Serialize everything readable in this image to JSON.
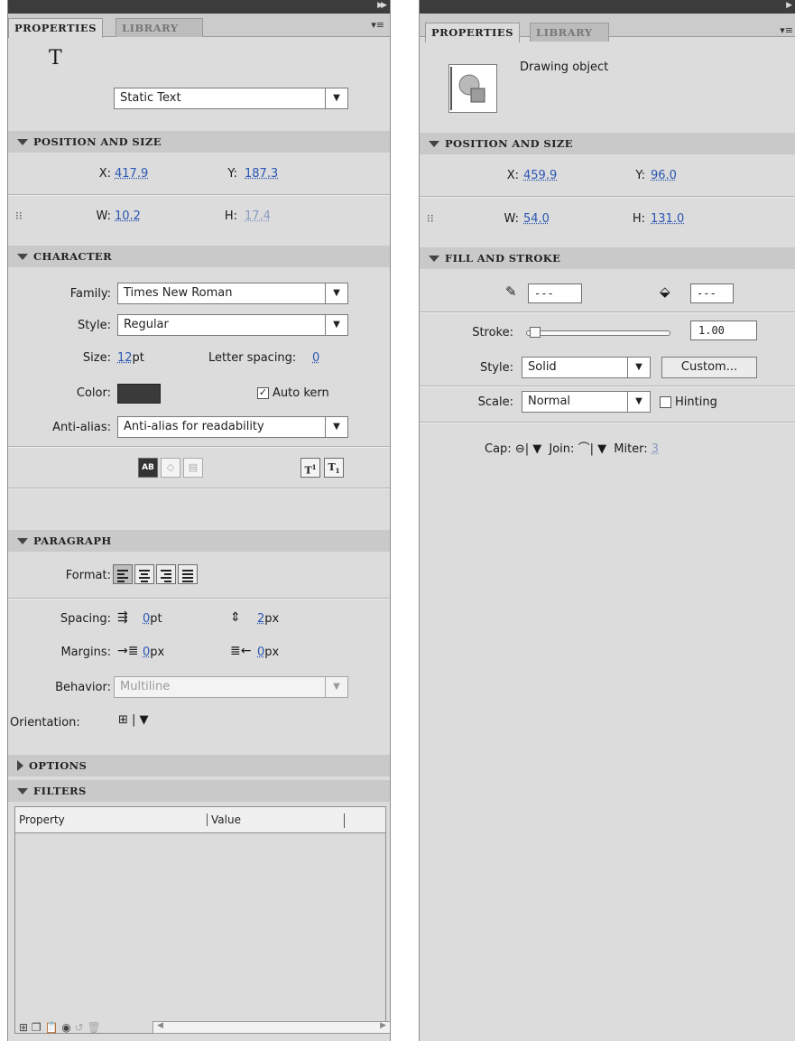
{
  "left": {
    "tabs": [
      "PROPERTIES",
      "LIBRARY"
    ],
    "text_tool_glyph": "T",
    "text_type": "Static Text",
    "position_size": {
      "header": "POSITION AND SIZE",
      "x_label": "X:",
      "x_value": "417.9",
      "y_label": "Y:",
      "y_value": "187.3",
      "w_label": "W:",
      "w_value": "10.2",
      "h_label": "H:",
      "h_value": "17.4"
    },
    "character": {
      "header": "CHARACTER",
      "family_label": "Family:",
      "family_value": "Times New Roman",
      "style_label": "Style:",
      "style_value": "Regular",
      "size_label": "Size:",
      "size_value": "12",
      "size_unit": "pt",
      "letter_spacing_label": "Letter spacing:",
      "letter_spacing_value": "0",
      "color_label": "Color:",
      "color_value": "#3a3a3a",
      "auto_kern_label": "Auto kern",
      "antialias_label": "Anti-alias:",
      "antialias_value": "Anti-alias for readability"
    },
    "paragraph": {
      "header": "PARAGRAPH",
      "format_label": "Format:",
      "spacing_label": "Spacing:",
      "spacing_indent_value": "0",
      "spacing_indent_unit": "pt",
      "spacing_line_value": "2",
      "spacing_line_unit": "px",
      "margins_label": "Margins:",
      "margin_left_value": "0",
      "margin_left_unit": "px",
      "margin_right_value": "0",
      "margin_right_unit": "px",
      "behavior_label": "Behavior:",
      "behavior_value": "Multiline",
      "orientation_label": "Orientation:"
    },
    "options_header": "OPTIONS",
    "filters": {
      "header": "FILTERS",
      "col_property": "Property",
      "col_value": "Value"
    }
  },
  "right": {
    "tabs": [
      "PROPERTIES",
      "LIBRARY"
    ],
    "object_type": "Drawing object",
    "position_size": {
      "header": "POSITION AND SIZE",
      "x_label": "X:",
      "x_value": "459.9",
      "y_label": "Y:",
      "y_value": "96.0",
      "w_label": "W:",
      "w_value": "54.0",
      "h_label": "H:",
      "h_value": "131.0"
    },
    "fill_stroke": {
      "header": "FILL AND STROKE",
      "stroke_color_value": "---",
      "fill_color_value": "---",
      "stroke_label": "Stroke:",
      "stroke_value": "1.00",
      "stroke_slider_fraction": 0.02,
      "style_label": "Style:",
      "style_value": "Solid",
      "custom_button": "Custom...",
      "scale_label": "Scale:",
      "scale_value": "Normal",
      "hinting_label": "Hinting",
      "cap_label": "Cap:",
      "join_label": "Join:",
      "miter_label": "Miter:",
      "miter_value": "3"
    }
  }
}
